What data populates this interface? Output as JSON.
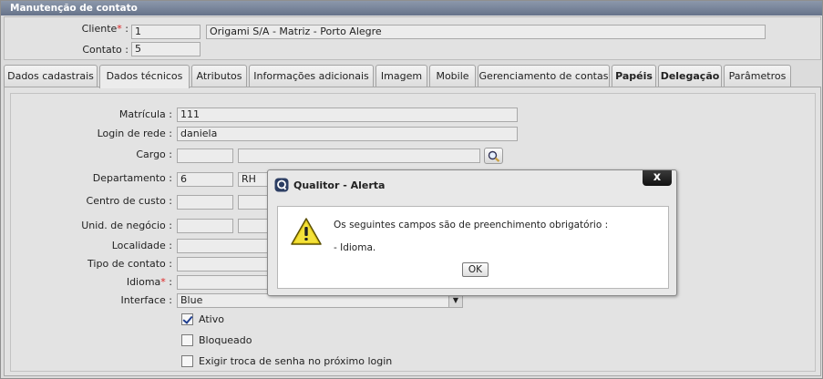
{
  "window": {
    "title": "Manutenção de contato"
  },
  "header": {
    "cliente_label": "Cliente",
    "cliente_required": "*",
    "cliente_colon": " :",
    "cliente_code": "1",
    "cliente_name": "Origami S/A - Matriz - Porto Alegre",
    "contato_label": "Contato :",
    "contato_value": "5"
  },
  "tabs": [
    {
      "label": "Dados cadastrais"
    },
    {
      "label": "Dados técnicos"
    },
    {
      "label": "Atributos"
    },
    {
      "label": "Informações adicionais"
    },
    {
      "label": "Imagem"
    },
    {
      "label": "Mobile"
    },
    {
      "label": "Gerenciamento de contas"
    },
    {
      "label": "Papéis"
    },
    {
      "label": "Delegação"
    },
    {
      "label": "Parâmetros"
    }
  ],
  "form": {
    "matricula_label": "Matrícula :",
    "matricula_value": "111",
    "login_label": "Login de rede :",
    "login_value": "daniela",
    "cargo_label": "Cargo :",
    "cargo_code": "",
    "cargo_name": "",
    "departamento_label": "Departamento :",
    "departamento_code": "6",
    "departamento_name": "RH",
    "centro_label": "Centro de custo :",
    "unid_label": "Unid. de negócio :",
    "localidade_label": "Localidade :",
    "tipo_label": "Tipo de contato :",
    "idioma_label": "Idioma",
    "idioma_required": "*",
    "idioma_colon": " :",
    "interface_label": "Interface :",
    "interface_value": "Blue",
    "ativo_label": "Ativo",
    "ativo_checked": true,
    "bloqueado_label": "Bloqueado",
    "bloqueado_checked": false,
    "exigir_label": "Exigir troca de senha no próximo login",
    "exigir_checked": false
  },
  "dialog": {
    "title": "Qualitor - Alerta",
    "close_label": "x",
    "message_line1": "Os seguintes campos são de preenchimento obrigatório :",
    "message_line2": "- Idioma.",
    "ok_label": "OK",
    "icon": "warning-icon"
  },
  "colors": {
    "titlebar": "#66738a",
    "required": "#dd2222",
    "close_button": "#111111"
  }
}
